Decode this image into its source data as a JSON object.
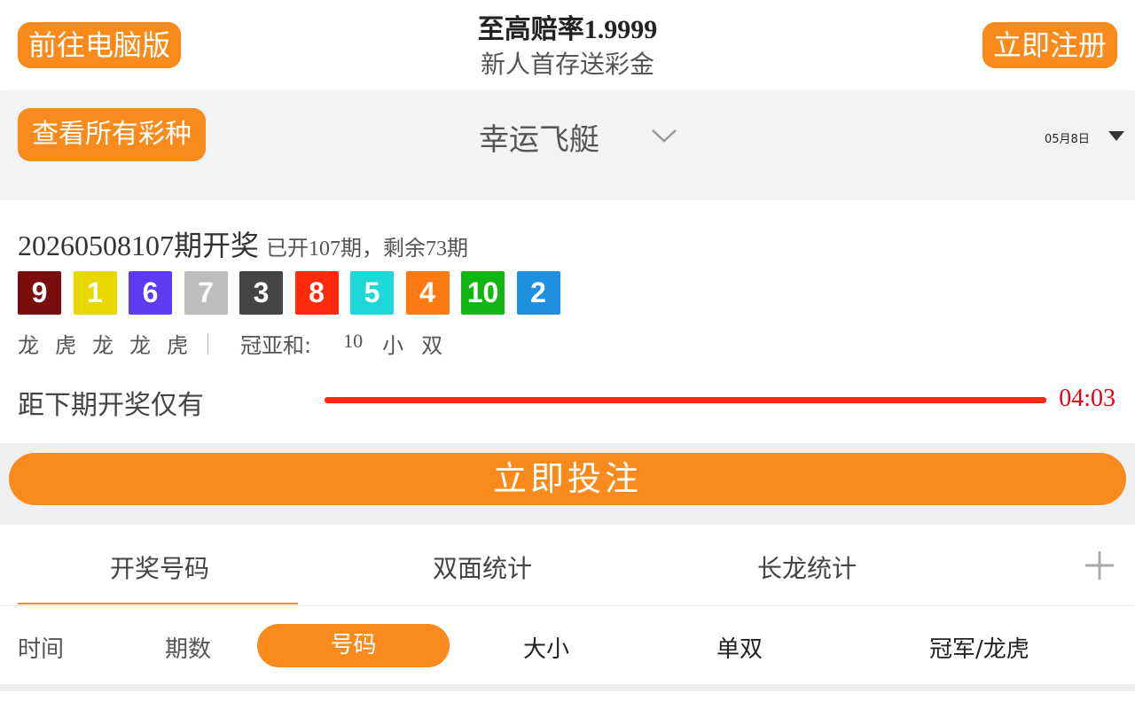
{
  "header": {
    "pc_button": "前往电脑版",
    "register_button": "立即注册",
    "promo_title": "至高赔率",
    "promo_odds": "1.9999",
    "promo_subtitle": "新人首存送彩金"
  },
  "game_bar": {
    "all_lotteries_button": "查看所有彩种",
    "game_name": "幸运飞艇",
    "date": "05月8日"
  },
  "draw": {
    "issue": "20260508107",
    "issue_suffix": "期开奖",
    "progress_text": "已开107期，剩余73期",
    "balls": [
      {
        "number": "9",
        "color": "#7a0e0e"
      },
      {
        "number": "1",
        "color": "#e6d800"
      },
      {
        "number": "6",
        "color": "#5c3bf2"
      },
      {
        "number": "7",
        "color": "#bdbdbd"
      },
      {
        "number": "3",
        "color": "#444444"
      },
      {
        "number": "8",
        "color": "#ff2a0a"
      },
      {
        "number": "5",
        "color": "#1ed8d8"
      },
      {
        "number": "4",
        "color": "#ff7a10"
      },
      {
        "number": "10",
        "color": "#12b612"
      },
      {
        "number": "2",
        "color": "#1f90e0"
      }
    ],
    "dragon_tiger": [
      "龙",
      "虎",
      "龙",
      "龙",
      "虎"
    ],
    "sum_label": "冠亚和:",
    "sum_value": "10",
    "sum_size": "小",
    "sum_parity": "双",
    "countdown_label": "距下期开奖仅有",
    "countdown": "04:03",
    "countdown_remaining_fraction": 1.0
  },
  "bet_button": "立即投注",
  "tabs": [
    "开奖号码",
    "双面统计",
    "长龙统计"
  ],
  "subtabs": [
    "时间",
    "期数",
    "号码",
    "大小",
    "单双",
    "冠军/龙虎"
  ],
  "colors": {
    "accent": "#f98a1c",
    "countdown": "#e60012",
    "progress": "#ff2a0a"
  }
}
